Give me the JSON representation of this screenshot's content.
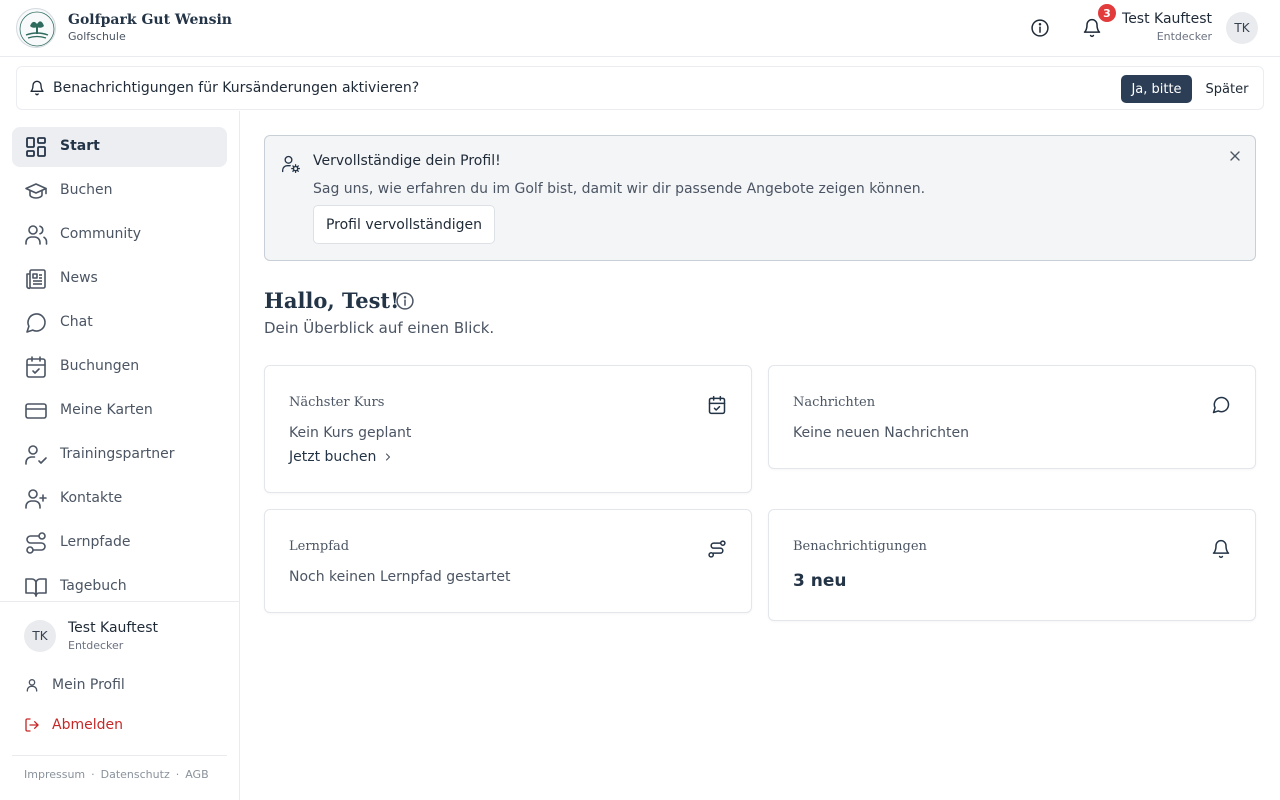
{
  "header": {
    "brand_name": "Golfpark Gut Wensin",
    "brand_sub": "Golfschule",
    "notification_count": "3",
    "user_name": "Test Kauftest",
    "user_role": "Entdecker",
    "user_initials": "TK"
  },
  "notification_banner": {
    "text": "Benachrichtigungen für Kursänderungen aktivieren?",
    "accept_label": "Ja, bitte",
    "later_label": "Später"
  },
  "sidebar": {
    "items": [
      {
        "label": "Start",
        "icon": "grid-icon",
        "active": true
      },
      {
        "label": "Buchen",
        "icon": "graduation-cap-icon"
      },
      {
        "label": "Community",
        "icon": "users-icon"
      },
      {
        "label": "News",
        "icon": "newspaper-icon"
      },
      {
        "label": "Chat",
        "icon": "chat-bubble-icon"
      },
      {
        "label": "Buchungen",
        "icon": "calendar-check-icon"
      },
      {
        "label": "Meine Karten",
        "icon": "credit-card-icon"
      },
      {
        "label": "Trainingspartner",
        "icon": "user-check-icon"
      },
      {
        "label": "Kontakte",
        "icon": "user-plus-icon"
      },
      {
        "label": "Lernpfade",
        "icon": "route-icon"
      },
      {
        "label": "Tagebuch",
        "icon": "book-open-icon"
      }
    ],
    "user_name": "Test Kauftest",
    "user_role": "Entdecker",
    "user_initials": "TK",
    "profile_label": "Mein Profil",
    "logout_label": "Abmelden",
    "footer": {
      "impressum": "Impressum",
      "datenschutz": "Datenschutz",
      "agb": "AGB",
      "separator": "·"
    }
  },
  "profile_prompt": {
    "title": "Vervollständige dein Profil!",
    "description": "Sag uns, wie erfahren du im Golf bist, damit wir dir passende Angebote zeigen können.",
    "button_label": "Profil vervollständigen"
  },
  "main": {
    "greeting": "Hallo, Test!",
    "subtitle": "Dein Überblick auf einen Blick.",
    "cards": {
      "next_course": {
        "title": "Nächster Kurs",
        "text": "Kein Kurs geplant",
        "link": "Jetzt buchen"
      },
      "messages": {
        "title": "Nachrichten",
        "text": "Keine neuen Nachrichten"
      },
      "learning_path": {
        "title": "Lernpfad",
        "text": "Noch keinen Lernpfad gestartet"
      },
      "notifications": {
        "title": "Benachrichtigungen",
        "value": "3 neu"
      }
    }
  },
  "colors": {
    "primary": "#2c3e55",
    "badge": "#e23b3b",
    "logout": "#c62828"
  }
}
